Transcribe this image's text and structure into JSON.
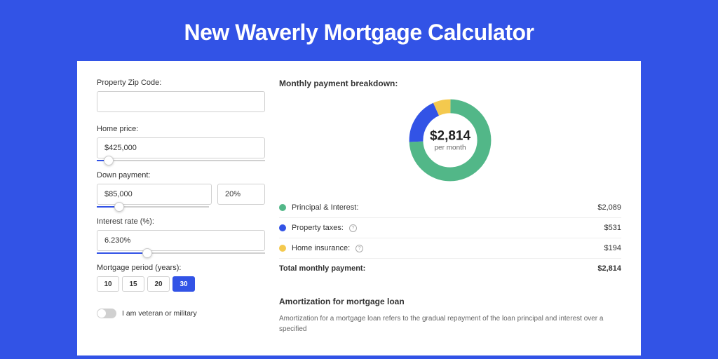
{
  "page_title": "New Waverly Mortgage Calculator",
  "form": {
    "zip_label": "Property Zip Code:",
    "zip_value": "",
    "home_price_label": "Home price:",
    "home_price_value": "$425,000",
    "home_price_slider_pct": 7,
    "down_payment_label": "Down payment:",
    "down_payment_value": "$85,000",
    "down_payment_pct_value": "20%",
    "down_payment_slider_pct": 20,
    "interest_label": "Interest rate (%):",
    "interest_value": "6.230%",
    "interest_slider_pct": 30,
    "period_label": "Mortgage period (years):",
    "period_options": [
      "10",
      "15",
      "20",
      "30"
    ],
    "period_selected": "30",
    "veteran_label": "I am veteran or military"
  },
  "breakdown": {
    "title": "Monthly payment breakdown:",
    "center_amount": "$2,814",
    "center_sub": "per month",
    "items": [
      {
        "label": "Principal & Interest:",
        "value": "$2,089",
        "color": "#52b788"
      },
      {
        "label": "Property taxes:",
        "value": "$531",
        "color": "#3253e6",
        "info": true
      },
      {
        "label": "Home insurance:",
        "value": "$194",
        "color": "#f4c94e",
        "info": true
      }
    ],
    "total_label": "Total monthly payment:",
    "total_value": "$2,814"
  },
  "chart_data": {
    "type": "pie",
    "title": "Monthly payment breakdown",
    "series": [
      {
        "name": "Principal & Interest",
        "value": 2089,
        "color": "#52b788"
      },
      {
        "name": "Property taxes",
        "value": 531,
        "color": "#3253e6"
      },
      {
        "name": "Home insurance",
        "value": 194,
        "color": "#f4c94e"
      }
    ],
    "total": 2814,
    "center_label": "$2,814",
    "center_sub_label": "per month",
    "donut": true
  },
  "amortization": {
    "title": "Amortization for mortgage loan",
    "text": "Amortization for a mortgage loan refers to the gradual repayment of the loan principal and interest over a specified"
  }
}
